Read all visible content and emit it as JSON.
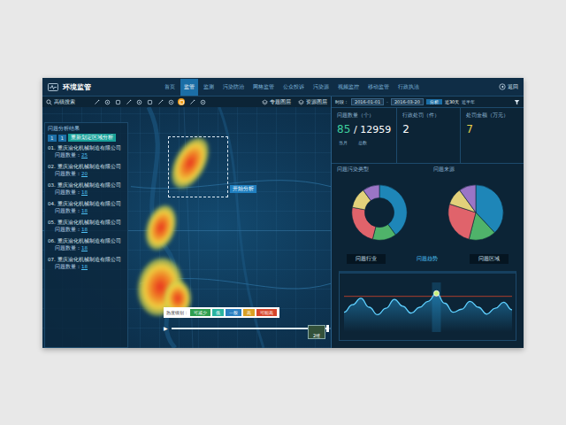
{
  "app": {
    "title": "环境监管",
    "back": "返回"
  },
  "nav": [
    {
      "label": "首页",
      "selected": false
    },
    {
      "label": "监管",
      "selected": true
    },
    {
      "label": "监测",
      "selected": false
    },
    {
      "label": "污染防治",
      "selected": false
    },
    {
      "label": "网格监管",
      "selected": false
    },
    {
      "label": "公众投诉",
      "selected": false
    },
    {
      "label": "污染源",
      "selected": false
    },
    {
      "label": "视频监控",
      "selected": false
    },
    {
      "label": "移动监管",
      "selected": false
    },
    {
      "label": "行政执法",
      "selected": false
    }
  ],
  "toolbar": {
    "search": "高级搜索",
    "tools": [
      {
        "selected": false
      },
      {
        "selected": false
      },
      {
        "selected": false
      },
      {
        "selected": false
      },
      {
        "selected": false
      },
      {
        "selected": false
      },
      {
        "selected": false
      },
      {
        "selected": false
      },
      {
        "selected": true
      },
      {
        "selected": false
      },
      {
        "selected": false
      }
    ],
    "layers": [
      "专题图层",
      "资源图层"
    ]
  },
  "time_filter": {
    "label": "时段：",
    "start": "2016-01-01",
    "end": "2016-03-20",
    "button": "分析",
    "quick": [
      {
        "label": "近30天",
        "selected": true
      },
      {
        "label": "近半年",
        "selected": false
      }
    ]
  },
  "results": {
    "title": "问题分析结果",
    "pager": [
      "1",
      "1"
    ],
    "reanalyze": "重新划定区域分析",
    "count_label": "问题数量：",
    "items": [
      {
        "index": "01.",
        "name": "重庆渝化机械制造有限公司",
        "count": "25"
      },
      {
        "index": "02.",
        "name": "重庆渝化机械制造有限公司",
        "count": "20"
      },
      {
        "index": "03.",
        "name": "重庆渝化机械制造有限公司",
        "count": "18"
      },
      {
        "index": "04.",
        "name": "重庆渝化机械制造有限公司",
        "count": "18"
      },
      {
        "index": "05.",
        "name": "重庆渝化机械制造有限公司",
        "count": "18"
      },
      {
        "index": "06.",
        "name": "重庆渝化机械制造有限公司",
        "count": "18"
      },
      {
        "index": "07.",
        "name": "重庆渝化机械制造有限公司",
        "count": "18"
      }
    ]
  },
  "map": {
    "analyze_label": "开始分析",
    "view_toggle": "2维"
  },
  "legend": {
    "label": "热度级别：",
    "levels": [
      {
        "label": "可减少",
        "color": "#2e9e4f"
      },
      {
        "label": "低",
        "color": "#2bb3a0"
      },
      {
        "label": "一般",
        "color": "#2a7fc0"
      },
      {
        "label": "高",
        "color": "#d9a024"
      },
      {
        "label": "可能高",
        "color": "#d6452b"
      }
    ]
  },
  "timeline": {
    "play": "▶",
    "level": 0.92
  },
  "stats": [
    {
      "label": "问题数量（个）",
      "value": "85",
      "total": "12959",
      "sub": [
        "当月",
        "总数"
      ],
      "color": "#3fd0a0"
    },
    {
      "label": "行政处罚（件）",
      "value": "2",
      "total": "",
      "sub": [],
      "color": "#ffffff"
    },
    {
      "label": "处罚金额（万元）",
      "value": "7",
      "total": "",
      "sub": [],
      "color": "#e8d24a"
    }
  ],
  "charts": [
    {
      "title": "问题污染类型",
      "kind": "donut",
      "segments": [
        {
          "value": 40,
          "color": "#1e86b8"
        },
        {
          "value": 14,
          "color": "#4fb36a"
        },
        {
          "value": 24,
          "color": "#e0636b"
        },
        {
          "value": 12,
          "color": "#e2d17a"
        },
        {
          "value": 10,
          "color": "#9b75c6"
        }
      ]
    },
    {
      "title": "问题来源",
      "kind": "pie",
      "segments": [
        {
          "value": 38,
          "color": "#1e86b8"
        },
        {
          "value": 16,
          "color": "#4fb36a"
        },
        {
          "value": 26,
          "color": "#e0636b"
        },
        {
          "value": 10,
          "color": "#e2d17a"
        },
        {
          "value": 10,
          "color": "#9b75c6"
        }
      ]
    }
  ],
  "chart_tabs": [
    {
      "label": "问题行业",
      "selected": false
    },
    {
      "label": "问题趋势",
      "selected": true
    },
    {
      "label": "问题区域",
      "selected": false
    }
  ],
  "trend": {
    "values": [
      40,
      55,
      68,
      50,
      35,
      48,
      66,
      52,
      38,
      50,
      62,
      78,
      58,
      40,
      46,
      62,
      50,
      36,
      48,
      60,
      45
    ],
    "threshold": 72,
    "highlight": 11
  }
}
